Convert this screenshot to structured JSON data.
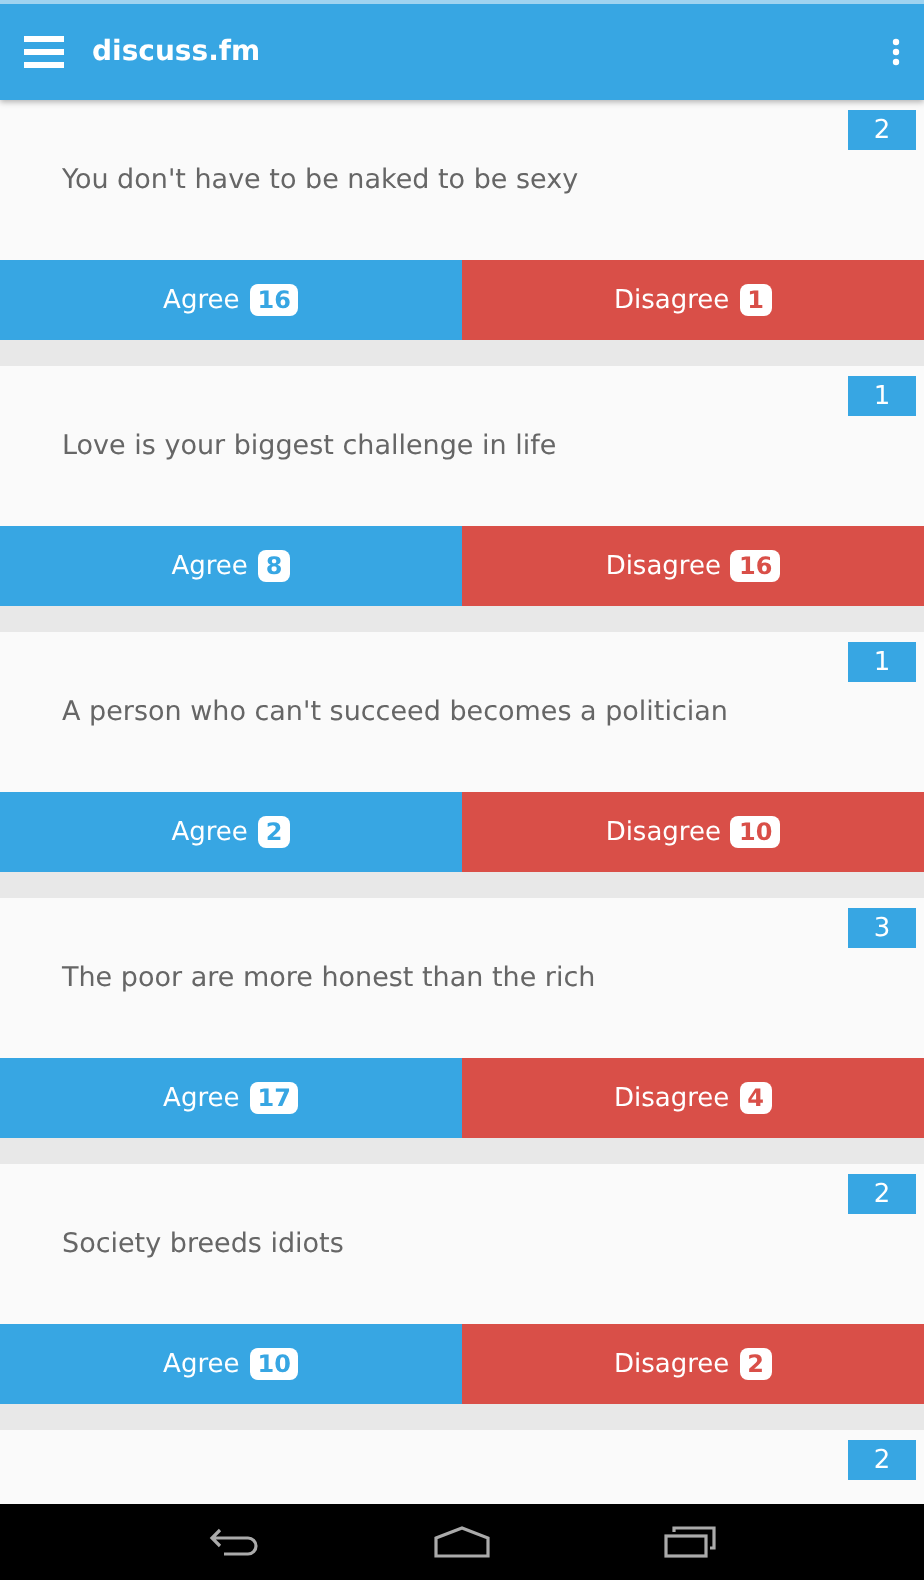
{
  "app_bar": {
    "title": "discuss.fm"
  },
  "cards": [
    {
      "count": "2",
      "statement": "You don't have to be naked to be sexy",
      "agree": {
        "label": "Agree",
        "count": "16"
      },
      "disagree": {
        "label": "Disagree",
        "count": "1"
      }
    },
    {
      "count": "1",
      "statement": "Love is your biggest challenge in life",
      "agree": {
        "label": "Agree",
        "count": "8"
      },
      "disagree": {
        "label": "Disagree",
        "count": "16"
      }
    },
    {
      "count": "1",
      "statement": "A person who can't succeed becomes a politician",
      "agree": {
        "label": "Agree",
        "count": "2"
      },
      "disagree": {
        "label": "Disagree",
        "count": "10"
      }
    },
    {
      "count": "3",
      "statement": "The poor are more honest than the rich",
      "agree": {
        "label": "Agree",
        "count": "17"
      },
      "disagree": {
        "label": "Disagree",
        "count": "4"
      }
    },
    {
      "count": "2",
      "statement": "Society breeds idiots",
      "agree": {
        "label": "Agree",
        "count": "10"
      },
      "disagree": {
        "label": "Disagree",
        "count": "2"
      }
    },
    {
      "count": "2"
    }
  ]
}
